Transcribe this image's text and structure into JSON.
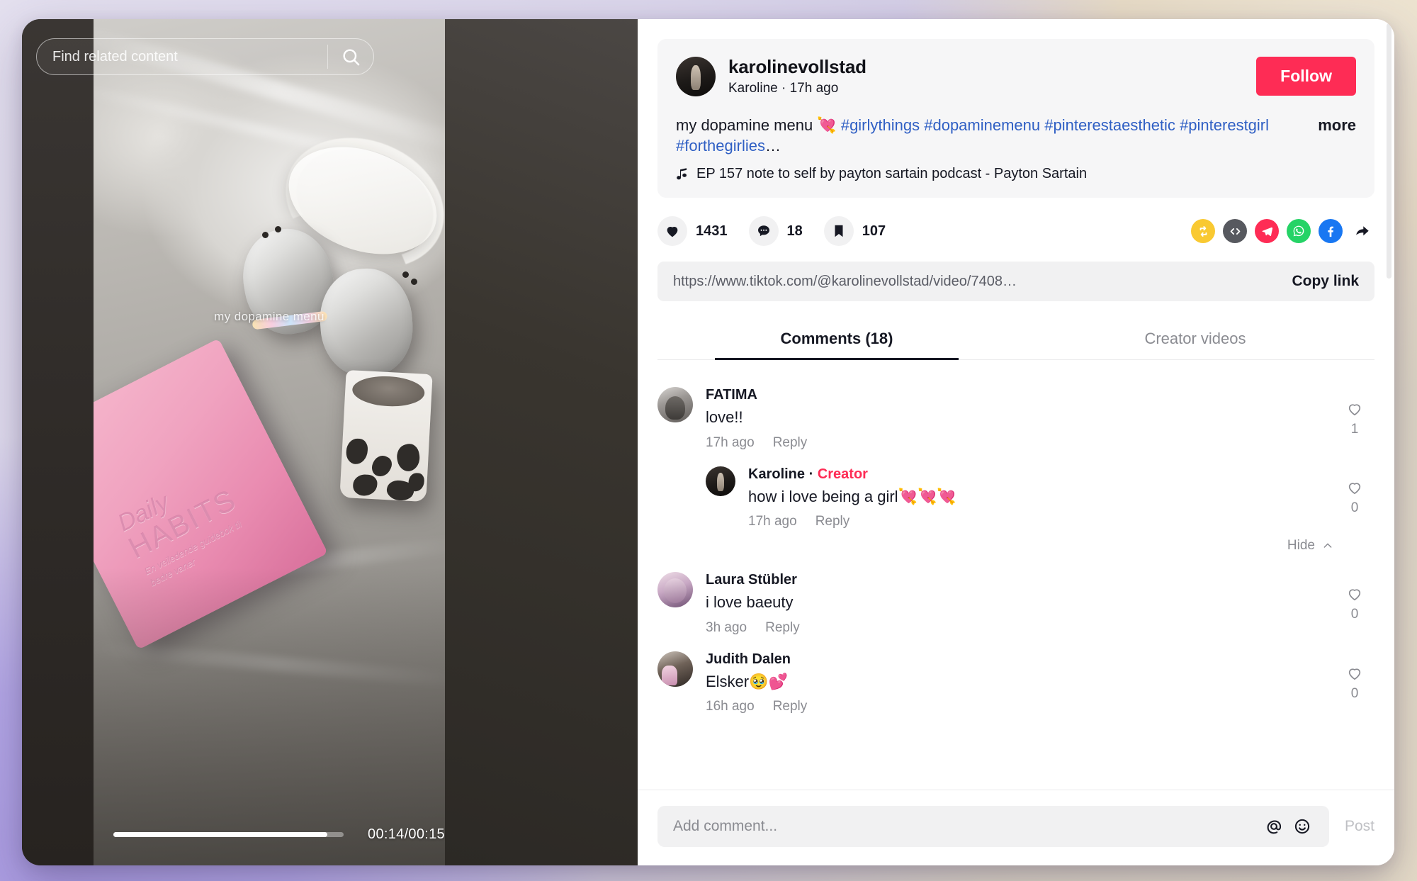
{
  "video": {
    "search_placeholder": "Find related content",
    "search_icon": "search-icon",
    "overlay_caption": "my dopamine menu",
    "journal_title_line1": "Daily",
    "journal_title_line2": "HABITS",
    "journal_subtitle": "En veiledende guidebok til bedre vaner",
    "current_time": "00:14",
    "duration": "00:15",
    "time_display": "00:14/00:15",
    "progress_percent": 93
  },
  "post": {
    "username": "karolinevollstad",
    "display_name": "Karoline",
    "separator": "·",
    "posted_ago": "17h ago",
    "meta_line": "Karoline · 17h ago",
    "follow_label": "Follow",
    "description_text": "my dopamine menu 💘 ",
    "hashtags": [
      "#girlythings",
      "#dopaminemenu",
      "#pinterestaesthetic",
      "#pinterestgirl",
      "#forthegirlies"
    ],
    "description_ellipsis": "…",
    "more_label": "more",
    "music_icon": "music-note-icon",
    "music_title": "EP 157 note to self by payton sartain podcast - Payton Sartain"
  },
  "actions": {
    "like": {
      "icon": "heart-filled-icon",
      "count": "1431"
    },
    "comment": {
      "icon": "comment-bubble-icon",
      "count": "18"
    },
    "bookmark": {
      "icon": "bookmark-filled-icon",
      "count": "107"
    },
    "share_buttons": [
      {
        "name": "repost-icon",
        "color": "#f9c932"
      },
      {
        "name": "embed-code-icon",
        "color": "#57595f"
      },
      {
        "name": "telegram-share-icon",
        "color": "#fe2c55"
      },
      {
        "name": "whatsapp-icon",
        "color": "#25d366"
      },
      {
        "name": "facebook-icon",
        "color": "#1877f2"
      },
      {
        "name": "share-arrow-icon",
        "color": "#161823"
      }
    ]
  },
  "link": {
    "url": "https://www.tiktok.com/@karolinevollstad/video/7408…",
    "copy_label": "Copy link"
  },
  "tabs": [
    {
      "label": "Comments (18)",
      "active": true
    },
    {
      "label": "Creator videos",
      "active": false
    }
  ],
  "comments": [
    {
      "name": "FATIMA",
      "text": "love!!",
      "time": "17h ago",
      "reply_label": "Reply",
      "likes": "1",
      "avatar": "ph1",
      "reply": {
        "name": "Karoline",
        "badge": "Creator",
        "separator": "·",
        "text": "how i love being a girl💘💘💘",
        "time": "17h ago",
        "reply_label": "Reply",
        "likes": "0",
        "avatar": "k"
      },
      "hide_label": "Hide"
    },
    {
      "name": "Laura Stübler",
      "text": "i love baeuty",
      "time": "3h ago",
      "reply_label": "Reply",
      "likes": "0",
      "avatar": "ph2"
    },
    {
      "name": "Judith Dalen",
      "text": "Elsker🥹💕",
      "time": "16h ago",
      "reply_label": "Reply",
      "likes": "0",
      "avatar": "ph3"
    }
  ],
  "composer": {
    "placeholder": "Add comment...",
    "mention_icon": "at-mention-icon",
    "emoji_icon": "emoji-smiley-icon",
    "post_label": "Post"
  },
  "colors": {
    "accent_red": "#fe2c55",
    "link_blue": "#2f5fc4",
    "text_primary": "#161823",
    "text_muted": "#8a8b91"
  }
}
